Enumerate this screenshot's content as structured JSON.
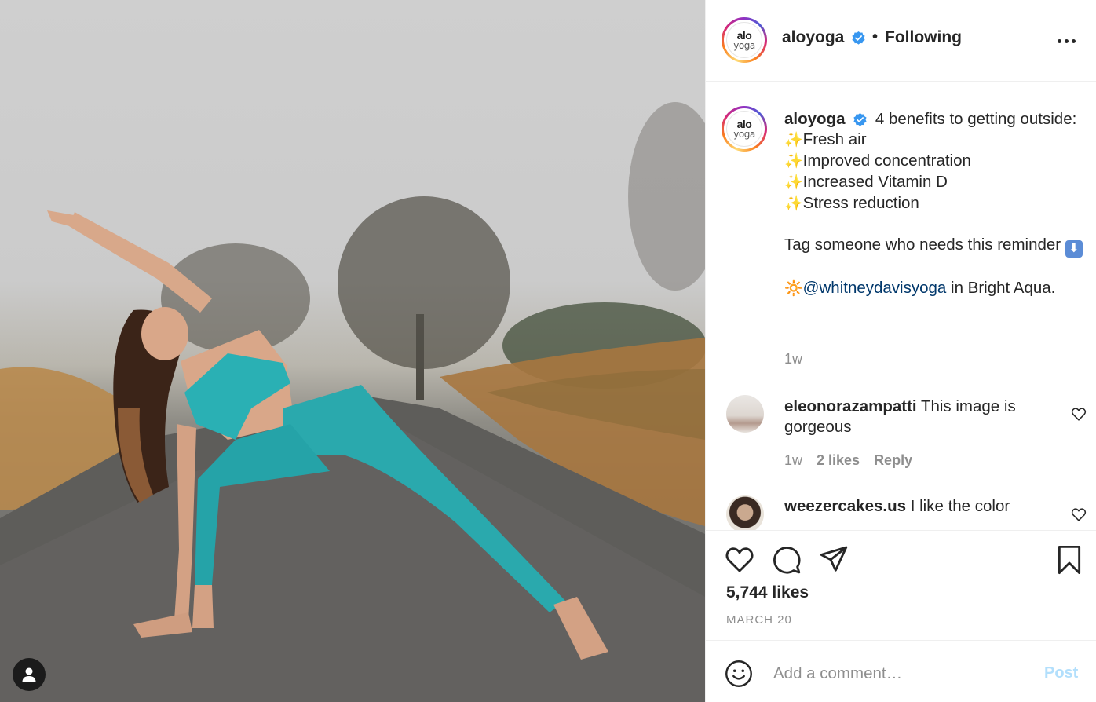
{
  "header": {
    "username": "aloyoga",
    "separator": "•",
    "follow_status": "Following",
    "avatar_logo": [
      "alo",
      "yoga"
    ]
  },
  "caption": {
    "username": "aloyoga",
    "intro": "4 benefits to getting outside:",
    "benefits": [
      "Fresh air",
      "Improved concentration",
      "Increased Vitamin D",
      "Stress reduction"
    ],
    "tag_text": "Tag someone who needs this reminder",
    "mention": "@whitneydavisyoga",
    "mention_suffix": " in Bright Aqua.",
    "time": "1w"
  },
  "comments": [
    {
      "username": "eleonorazampatti",
      "text": "This image is gorgeous",
      "time": "1w",
      "likes": "2 likes",
      "reply": "Reply"
    },
    {
      "username": "weezercakes.us",
      "text": "I like the color"
    }
  ],
  "post": {
    "likes": "5,744 likes",
    "date": "MARCH 20"
  },
  "composer": {
    "placeholder": "Add a comment…",
    "post_label": "Post"
  },
  "colors": {
    "verified": "#3897f0",
    "link": "#00376b",
    "muted": "#8e8e8e",
    "post_disabled": "#b2dffc",
    "outfit": "#2ab0b4"
  },
  "icons": [
    "heart-icon",
    "comment-icon",
    "share-icon",
    "bookmark-icon",
    "emoji-icon",
    "more-icon",
    "verified-icon",
    "user-tag-icon"
  ]
}
